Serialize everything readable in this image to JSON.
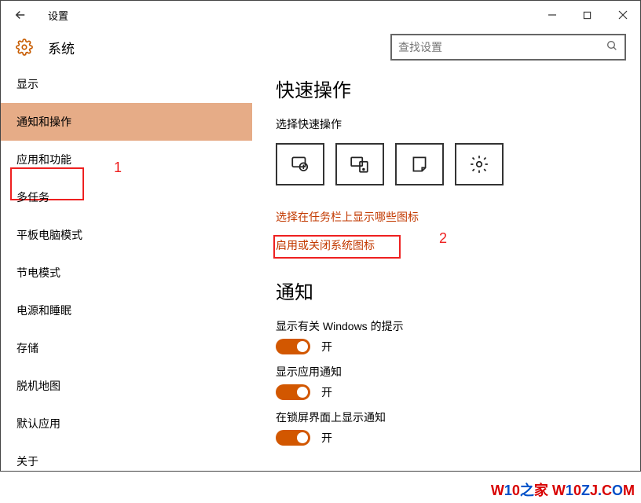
{
  "window": {
    "title": "设置"
  },
  "header": {
    "section_title": "系统",
    "search_placeholder": "查找设置"
  },
  "sidebar": {
    "items": [
      {
        "label": "显示"
      },
      {
        "label": "通知和操作"
      },
      {
        "label": "应用和功能"
      },
      {
        "label": "多任务"
      },
      {
        "label": "平板电脑模式"
      },
      {
        "label": "节电模式"
      },
      {
        "label": "电源和睡眠"
      },
      {
        "label": "存储"
      },
      {
        "label": "脱机地图"
      },
      {
        "label": "默认应用"
      },
      {
        "label": "关于"
      }
    ],
    "selected_index": 1
  },
  "annotations": {
    "label1": "1",
    "label2": "2"
  },
  "main": {
    "quick_actions": {
      "heading": "快速操作",
      "subhead": "选择快速操作",
      "tiles": [
        {
          "name": "tablet-mode"
        },
        {
          "name": "connect"
        },
        {
          "name": "note"
        },
        {
          "name": "all-settings"
        }
      ],
      "link1": "选择在任务栏上显示哪些图标",
      "link2": "启用或关闭系统图标"
    },
    "notifications": {
      "heading": "通知",
      "rows": [
        {
          "label": "显示有关 Windows 的提示",
          "state": "开",
          "on": true
        },
        {
          "label": "显示应用通知",
          "state": "开",
          "on": true
        },
        {
          "label": "在锁屏界面上显示通知",
          "state": "开",
          "on": true
        }
      ]
    }
  },
  "watermark": [
    "W",
    "1",
    "0",
    "之",
    "家",
    " ",
    "W",
    "1",
    "0",
    "Z",
    "J",
    ".",
    "C",
    "O",
    "M"
  ]
}
